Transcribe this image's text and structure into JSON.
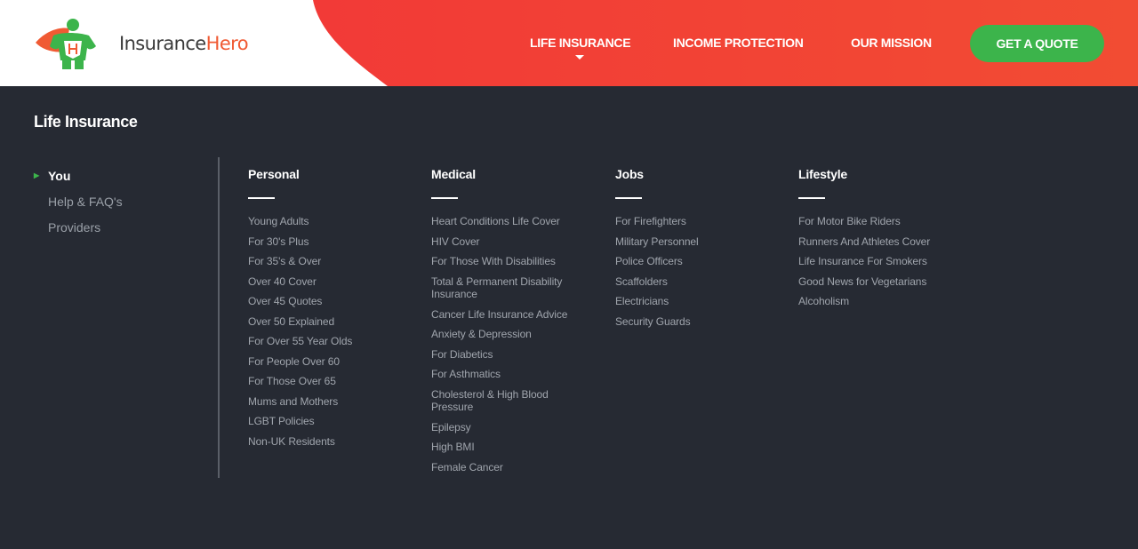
{
  "brand": {
    "name_part1": "Insurance",
    "name_part2": "Hero",
    "color_primary": "#f04a33",
    "color_accent": "#3cb44b"
  },
  "nav": {
    "items": [
      {
        "label": "LIFE INSURANCE"
      },
      {
        "label": "INCOME PROTECTION"
      },
      {
        "label": "OUR MISSION"
      }
    ],
    "cta": "GET A QUOTE"
  },
  "menu": {
    "title": "Life Insurance",
    "side": [
      {
        "label": "You"
      },
      {
        "label": "Help & FAQ's"
      },
      {
        "label": "Providers"
      }
    ],
    "columns": {
      "personal": {
        "heading": "Personal",
        "items": [
          "Young Adults",
          "For 30's Plus",
          "For 35's & Over",
          "Over 40 Cover",
          "Over 45 Quotes",
          "Over 50 Explained",
          "For Over 55 Year Olds",
          "For People Over 60",
          "For Those Over 65",
          "Mums and Mothers",
          "LGBT Policies",
          "Non-UK Residents"
        ]
      },
      "medical": {
        "heading": "Medical",
        "items": [
          "Heart Conditions Life Cover",
          "HIV Cover",
          "For Those With Disabilities",
          "Total & Permanent Disability Insurance",
          "Cancer Life Insurance Advice",
          "Anxiety & Depression",
          "For Diabetics",
          "For Asthmatics",
          "Cholesterol & High Blood Pressure",
          "Epilepsy",
          "High BMI",
          "Female Cancer"
        ]
      },
      "jobs": {
        "heading": "Jobs",
        "items": [
          "For Firefighters",
          "Military Personnel",
          "Police Officers",
          "Scaffolders",
          "Electricians",
          "Security Guards"
        ]
      },
      "lifestyle": {
        "heading": "Lifestyle",
        "items": [
          "For Motor Bike Riders",
          "Runners And Athletes Cover",
          "Life Insurance For Smokers",
          "Good News for Vegetarians",
          "Alcoholism"
        ]
      }
    }
  }
}
